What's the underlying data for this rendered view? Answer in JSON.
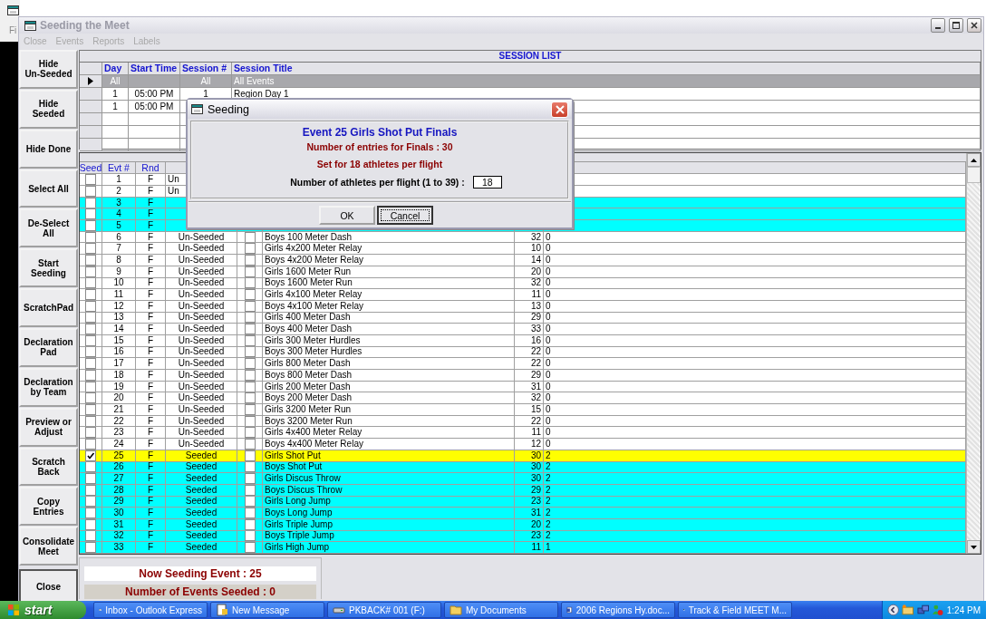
{
  "background_window": {
    "menu_fragment": "Fi"
  },
  "window": {
    "title": "Seeding the Meet"
  },
  "menu": [
    {
      "label": "Close",
      "disabled": true
    },
    {
      "label": "Events",
      "disabled": true
    },
    {
      "label": "Reports",
      "disabled": true
    },
    {
      "label": "Labels",
      "disabled": true
    }
  ],
  "side_buttons": [
    "Hide Un-Seeded",
    "Hide Seeded",
    "Hide Done",
    "Select All",
    "De-Select All",
    "Start Seeding",
    "ScratchPad",
    "Declaration Pad",
    "Declaration by Team",
    "Preview or Adjust",
    "Scratch Back",
    "Copy Entries",
    "Consolidate Meet",
    "Close"
  ],
  "session_list": {
    "title": "SESSION LIST",
    "columns": [
      "Day",
      "Start Time",
      "Session #",
      "Session Title"
    ],
    "rows": [
      {
        "selected": true,
        "day": "All",
        "session": "All",
        "title": "All Events"
      },
      {
        "selected": false,
        "day": "1",
        "start_time": "05:00 PM",
        "session": "1",
        "title": "Region Day 1"
      },
      {
        "selected": false,
        "day": "1",
        "start_time": "05:00 PM"
      }
    ]
  },
  "events": {
    "columns": [
      "Seed",
      "Evt #",
      "Rnd"
    ],
    "rows": [
      {
        "seed_checked": false,
        "evt": "1",
        "rnd": "F",
        "column_4": "Un",
        "color": "#ffffff"
      },
      {
        "seed_checked": false,
        "evt": "2",
        "rnd": "F",
        "column_4": "Un",
        "color": "#ffffff"
      },
      {
        "seed_checked": false,
        "evt": "3",
        "rnd": "F",
        "color": "#00ffff"
      },
      {
        "seed_checked": false,
        "evt": "4",
        "rnd": "F",
        "color": "#00ffff"
      },
      {
        "seed_checked": false,
        "evt": "5",
        "rnd": "F",
        "color": "#00ffff"
      },
      {
        "seed_checked": false,
        "evt": "6",
        "rnd": "F",
        "column_4": "Un-Seeded",
        "column_5_checked": false,
        "column_6": "Boys 100 Meter Dash",
        "column_7": "32",
        "column_8": "0",
        "color": "#ffffff"
      },
      {
        "seed_checked": false,
        "evt": "7",
        "rnd": "F",
        "column_4": "Un-Seeded",
        "column_5_checked": false,
        "column_6": "Girls 4x200 Meter Relay",
        "column_7": "10",
        "column_8": "0",
        "color": "#ffffff"
      },
      {
        "seed_checked": false,
        "evt": "8",
        "rnd": "F",
        "column_4": "Un-Seeded",
        "column_5_checked": false,
        "column_6": "Boys 4x200 Meter Relay",
        "column_7": "14",
        "column_8": "0",
        "color": "#ffffff"
      },
      {
        "seed_checked": false,
        "evt": "9",
        "rnd": "F",
        "column_4": "Un-Seeded",
        "column_5_checked": false,
        "column_6": "Girls 1600 Meter Run",
        "column_7": "20",
        "column_8": "0",
        "color": "#ffffff"
      },
      {
        "seed_checked": false,
        "evt": "10",
        "rnd": "F",
        "column_4": "Un-Seeded",
        "column_5_checked": false,
        "column_6": "Boys 1600 Meter Run",
        "column_7": "32",
        "column_8": "0",
        "color": "#ffffff"
      },
      {
        "seed_checked": false,
        "evt": "11",
        "rnd": "F",
        "column_4": "Un-Seeded",
        "column_5_checked": false,
        "column_6": "Girls 4x100 Meter Relay",
        "column_7": "11",
        "column_8": "0",
        "color": "#ffffff"
      },
      {
        "seed_checked": false,
        "evt": "12",
        "rnd": "F",
        "column_4": "Un-Seeded",
        "column_5_checked": false,
        "column_6": "Boys 4x100 Meter Relay",
        "column_7": "13",
        "column_8": "0",
        "color": "#ffffff"
      },
      {
        "seed_checked": false,
        "evt": "13",
        "rnd": "F",
        "column_4": "Un-Seeded",
        "column_5_checked": false,
        "column_6": "Girls 400 Meter Dash",
        "column_7": "29",
        "column_8": "0",
        "color": "#ffffff"
      },
      {
        "seed_checked": false,
        "evt": "14",
        "rnd": "F",
        "column_4": "Un-Seeded",
        "column_5_checked": false,
        "column_6": "Boys 400 Meter Dash",
        "column_7": "33",
        "column_8": "0",
        "color": "#ffffff"
      },
      {
        "seed_checked": false,
        "evt": "15",
        "rnd": "F",
        "column_4": "Un-Seeded",
        "column_5_checked": false,
        "column_6": "Girls 300 Meter Hurdles",
        "column_7": "16",
        "column_8": "0",
        "color": "#ffffff"
      },
      {
        "seed_checked": false,
        "evt": "16",
        "rnd": "F",
        "column_4": "Un-Seeded",
        "column_5_checked": false,
        "column_6": "Boys 300 Meter Hurdles",
        "column_7": "22",
        "column_8": "0",
        "color": "#ffffff"
      },
      {
        "seed_checked": false,
        "evt": "17",
        "rnd": "F",
        "column_4": "Un-Seeded",
        "column_5_checked": false,
        "column_6": "Girls 800 Meter Dash",
        "column_7": "22",
        "column_8": "0",
        "color": "#ffffff"
      },
      {
        "seed_checked": false,
        "evt": "18",
        "rnd": "F",
        "column_4": "Un-Seeded",
        "column_5_checked": false,
        "column_6": "Boys 800 Meter Dash",
        "column_7": "29",
        "column_8": "0",
        "color": "#ffffff"
      },
      {
        "seed_checked": false,
        "evt": "19",
        "rnd": "F",
        "column_4": "Un-Seeded",
        "column_5_checked": false,
        "column_6": "Girls 200 Meter Dash",
        "column_7": "31",
        "column_8": "0",
        "color": "#ffffff"
      },
      {
        "seed_checked": false,
        "evt": "20",
        "rnd": "F",
        "column_4": "Un-Seeded",
        "column_5_checked": false,
        "column_6": "Boys 200 Meter Dash",
        "column_7": "32",
        "column_8": "0",
        "color": "#ffffff"
      },
      {
        "seed_checked": false,
        "evt": "21",
        "rnd": "F",
        "column_4": "Un-Seeded",
        "column_5_checked": false,
        "column_6": "Girls 3200 Meter Run",
        "column_7": "15",
        "column_8": "0",
        "color": "#ffffff"
      },
      {
        "seed_checked": false,
        "evt": "22",
        "rnd": "F",
        "column_4": "Un-Seeded",
        "column_5_checked": false,
        "column_6": "Boys 3200 Meter Run",
        "column_7": "22",
        "column_8": "0",
        "color": "#ffffff"
      },
      {
        "seed_checked": false,
        "evt": "23",
        "rnd": "F",
        "column_4": "Un-Seeded",
        "column_5_checked": false,
        "column_6": "Girls 4x400 Meter Relay",
        "column_7": "11",
        "column_8": "0",
        "color": "#ffffff"
      },
      {
        "seed_checked": false,
        "evt": "24",
        "rnd": "F",
        "column_4": "Un-Seeded",
        "column_5_checked": false,
        "column_6": "Boys 4x400 Meter Relay",
        "column_7": "12",
        "column_8": "0",
        "color": "#ffffff"
      },
      {
        "seed_checked": true,
        "evt": "25",
        "rnd": "F",
        "column_4": "Seeded",
        "column_5_checked": false,
        "column_6": "Girls Shot Put",
        "column_7": "30",
        "column_8": "2",
        "color": "#ffff00"
      },
      {
        "seed_checked": false,
        "evt": "26",
        "rnd": "F",
        "column_4": "Seeded",
        "column_5_checked": false,
        "column_6": "Boys Shot Put",
        "column_7": "30",
        "column_8": "2",
        "color": "#00ffff"
      },
      {
        "seed_checked": false,
        "evt": "27",
        "rnd": "F",
        "column_4": "Seeded",
        "column_5_checked": false,
        "column_6": "Girls Discus Throw",
        "column_7": "30",
        "column_8": "2",
        "color": "#00ffff"
      },
      {
        "seed_checked": false,
        "evt": "28",
        "rnd": "F",
        "column_4": "Seeded",
        "column_5_checked": false,
        "column_6": "Boys Discus Throw",
        "column_7": "29",
        "column_8": "2",
        "color": "#00ffff"
      },
      {
        "seed_checked": false,
        "evt": "29",
        "rnd": "F",
        "column_4": "Seeded",
        "column_5_checked": false,
        "column_6": "Girls Long Jump",
        "column_7": "23",
        "column_8": "2",
        "color": "#00ffff"
      },
      {
        "seed_checked": false,
        "evt": "30",
        "rnd": "F",
        "column_4": "Seeded",
        "column_5_checked": false,
        "column_6": "Boys Long Jump",
        "column_7": "31",
        "column_8": "2",
        "color": "#00ffff"
      },
      {
        "seed_checked": false,
        "evt": "31",
        "rnd": "F",
        "column_4": "Seeded",
        "column_5_checked": false,
        "column_6": "Girls Triple Jump",
        "column_7": "20",
        "column_8": "2",
        "color": "#00ffff"
      },
      {
        "seed_checked": false,
        "evt": "32",
        "rnd": "F",
        "column_4": "Seeded",
        "column_5_checked": false,
        "column_6": "Boys Triple Jump",
        "column_7": "23",
        "column_8": "2",
        "color": "#00ffff"
      },
      {
        "seed_checked": false,
        "evt": "33",
        "rnd": "F",
        "column_4": "Seeded",
        "column_5_checked": false,
        "column_6": "Girls High Jump",
        "column_7": "11",
        "column_8": "1",
        "color": "#00ffff"
      }
    ]
  },
  "status_panel": {
    "now_seeding": "Now Seeding Event : 25",
    "events_seeded": "Number of Events Seeded : 0"
  },
  "dialog": {
    "title": "Seeding",
    "heading": "Event 25 Girls Shot Put Finals",
    "entries": "Number of entries for Finals : 30",
    "set_for": "Set for 18 athletes per flight",
    "field_label": "Number of athletes per flight (1 to 39) :",
    "field_value": "18",
    "buttons": [
      {
        "label": "OK",
        "focused": false
      },
      {
        "label": "Cancel",
        "focused": true
      }
    ]
  },
  "taskbar": {
    "start": "start",
    "tasks": [
      {
        "label": "Inbox - Outlook Express",
        "kind": "mail"
      },
      {
        "label": "New Message",
        "kind": "compose"
      },
      {
        "label": "PKBACK# 001 (F:)",
        "kind": "drive"
      },
      {
        "label": "My Documents",
        "kind": "folder"
      },
      {
        "label": "2006 Regions Hy.doc...",
        "kind": "document"
      },
      {
        "label": "Track & Field MEET M...",
        "kind": "app"
      }
    ],
    "clock": "1:24 PM"
  }
}
